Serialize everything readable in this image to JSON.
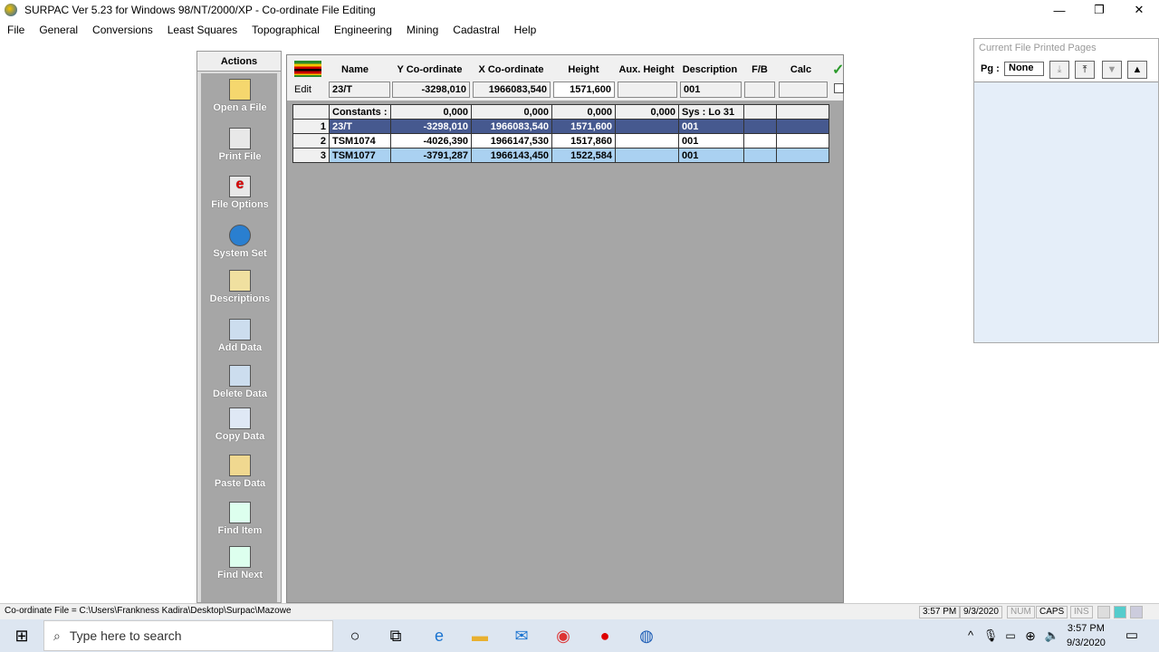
{
  "title": "SURPAC Ver 5.23 for Windows 98/NT/2000/XP - Co-ordinate File Editing",
  "menu": [
    "File",
    "General",
    "Conversions",
    "Least Squares",
    "Topographical",
    "Engineering",
    "Mining",
    "Cadastral",
    "Help"
  ],
  "actions": {
    "header": "Actions",
    "items": [
      "Open a File",
      "Print File",
      "File Options",
      "System Set",
      "Descriptions",
      "Add Data",
      "Delete Data",
      "Copy Data",
      "Paste Data",
      "Find Item",
      "Find Next"
    ]
  },
  "grid": {
    "columns": [
      "Name",
      "Y Co-ordinate",
      "X Co-ordinate",
      "Height",
      "Aux. Height",
      "Description",
      "F/B",
      "Calc"
    ],
    "edit_label": "Edit",
    "edit": {
      "name": "23/T",
      "y": "-3298,010",
      "x": "1966083,540",
      "height": "1571,600",
      "aux": "",
      "desc": "001",
      "fb": "",
      "calc": ""
    },
    "constants": {
      "label": "Constants :",
      "y": "0,000",
      "x": "0,000",
      "height": "0,000",
      "aux": "0,000",
      "desc": "Sys : Lo 31"
    },
    "rows": [
      {
        "n": "1",
        "name": "23/T",
        "y": "-3298,010",
        "x": "1966083,540",
        "height": "1571,600",
        "aux": "",
        "desc": "001"
      },
      {
        "n": "2",
        "name": "TSM1074",
        "y": "-4026,390",
        "x": "1966147,530",
        "height": "1517,860",
        "aux": "",
        "desc": "001"
      },
      {
        "n": "3",
        "name": "TSM1077",
        "y": "-3791,287",
        "x": "1966143,450",
        "height": "1522,584",
        "aux": "",
        "desc": "001"
      }
    ]
  },
  "printed": {
    "title": "Current File Printed Pages",
    "pg_label": "Pg :",
    "pg_value": "None"
  },
  "status": {
    "file": "Co-ordinate File = C:\\Users\\Frankness Kadira\\Desktop\\Surpac\\Mazowe",
    "time": "3:57 PM",
    "date": "9/3/2020",
    "num": "NUM",
    "caps": "CAPS",
    "ins": "INS"
  },
  "taskbar": {
    "search_placeholder": "Type here to search",
    "time": "3:57 PM",
    "date": "9/3/2020"
  }
}
